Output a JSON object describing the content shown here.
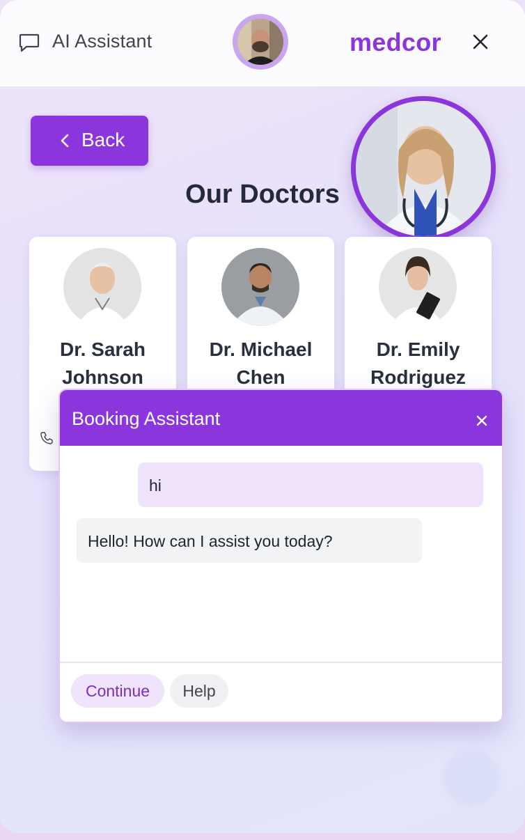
{
  "header": {
    "title": "AI Assistant",
    "brand": "medcor",
    "icons": {
      "chat": "chat-bubble-icon",
      "close": "close-icon"
    }
  },
  "nav": {
    "back_label": "Back"
  },
  "page": {
    "title": "Our Doctors"
  },
  "doctors": [
    {
      "name": "Dr. Sarah Johnson",
      "photo": "doctor-photo"
    },
    {
      "name": "Dr. Michael Chen",
      "photo": "doctor-photo"
    },
    {
      "name": "Dr. Emily Rodriguez",
      "photo": "doctor-photo"
    }
  ],
  "chat": {
    "title": "Booking Assistant",
    "messages": [
      {
        "from": "user",
        "text": "hi"
      },
      {
        "from": "bot",
        "text": "Hello! How can I assist you today?"
      }
    ],
    "quick_replies": [
      "Continue",
      "Help"
    ]
  },
  "colors": {
    "accent": "#8b35dc",
    "brand": "#8b35dc",
    "user_bubble": "#efe4fb",
    "bot_bubble": "#f2f3f5"
  }
}
